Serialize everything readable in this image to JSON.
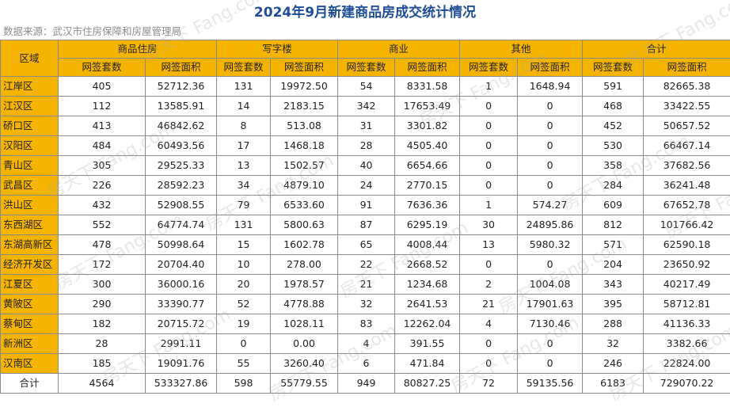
{
  "title": "2024年9月新建商品房成交统计情况",
  "source": "数据来源：武汉市住房保障和房屋管理局",
  "watermark": "房天下 Fang.com",
  "table": {
    "corner": "区域",
    "groups": [
      "商品住房",
      "写字楼",
      "商业",
      "其他",
      "合计"
    ],
    "subheaders": [
      "网签套数",
      "网签面积"
    ],
    "rows": [
      {
        "region": "江岸区",
        "cells": [
          "405",
          "52712.36",
          "131",
          "19972.50",
          "54",
          "8331.58",
          "1",
          "1648.94",
          "591",
          "82665.38"
        ]
      },
      {
        "region": "江汉区",
        "cells": [
          "112",
          "13585.91",
          "14",
          "2183.15",
          "342",
          "17653.49",
          "0",
          "0",
          "468",
          "33422.55"
        ]
      },
      {
        "region": "硚口区",
        "cells": [
          "413",
          "46842.62",
          "8",
          "513.08",
          "31",
          "3301.82",
          "0",
          "0",
          "452",
          "50657.52"
        ]
      },
      {
        "region": "汉阳区",
        "cells": [
          "484",
          "60493.56",
          "17",
          "1468.18",
          "28",
          "4505.40",
          "0",
          "0",
          "530",
          "66467.14"
        ]
      },
      {
        "region": "青山区",
        "cells": [
          "305",
          "29525.33",
          "13",
          "1502.57",
          "40",
          "6654.66",
          "0",
          "0",
          "358",
          "37682.56"
        ]
      },
      {
        "region": "武昌区",
        "cells": [
          "226",
          "28592.23",
          "34",
          "4879.10",
          "24",
          "2770.15",
          "0",
          "0",
          "284",
          "36241.48"
        ]
      },
      {
        "region": "洪山区",
        "cells": [
          "432",
          "52908.55",
          "79",
          "6533.60",
          "91",
          "7636.36",
          "1",
          "574.27",
          "609",
          "67652.78"
        ]
      },
      {
        "region": "东西湖区",
        "cells": [
          "552",
          "64774.74",
          "131",
          "5800.63",
          "87",
          "6295.19",
          "30",
          "24895.86",
          "812",
          "101766.42"
        ]
      },
      {
        "region": "东湖高新区",
        "cells": [
          "478",
          "50998.64",
          "15",
          "1602.78",
          "65",
          "4008.44",
          "13",
          "5980.32",
          "571",
          "62590.18"
        ]
      },
      {
        "region": "经济开发区",
        "cells": [
          "172",
          "20704.40",
          "10",
          "278.00",
          "22",
          "2668.52",
          "0",
          "0",
          "204",
          "23650.92"
        ]
      },
      {
        "region": "江夏区",
        "cells": [
          "300",
          "36000.16",
          "20",
          "1978.57",
          "21",
          "1234.68",
          "2",
          "1004.08",
          "343",
          "40217.49"
        ]
      },
      {
        "region": "黄陂区",
        "cells": [
          "290",
          "33390.77",
          "52",
          "4778.88",
          "32",
          "2641.53",
          "21",
          "17901.63",
          "395",
          "58712.81"
        ]
      },
      {
        "region": "蔡甸区",
        "cells": [
          "182",
          "20715.72",
          "19",
          "1028.11",
          "83",
          "12262.04",
          "4",
          "7130.46",
          "288",
          "41136.33"
        ]
      },
      {
        "region": "新洲区",
        "cells": [
          "28",
          "2991.11",
          "0",
          "0.00",
          "4",
          "391.55",
          "0",
          "0",
          "32",
          "3382.66"
        ]
      },
      {
        "region": "汉南区",
        "cells": [
          "185",
          "19091.76",
          "55",
          "3260.40",
          "6",
          "471.84",
          "0",
          "0",
          "246",
          "22824.00"
        ]
      }
    ],
    "total": {
      "label": "合计",
      "cells": [
        "4564",
        "533327.86",
        "598",
        "55779.55",
        "949",
        "80827.25",
        "72",
        "59135.56",
        "6183",
        "729070.22"
      ]
    }
  },
  "colors": {
    "header_bg": "#f5b400",
    "title": "#1f4e96",
    "grid": "#8a8a8a"
  }
}
